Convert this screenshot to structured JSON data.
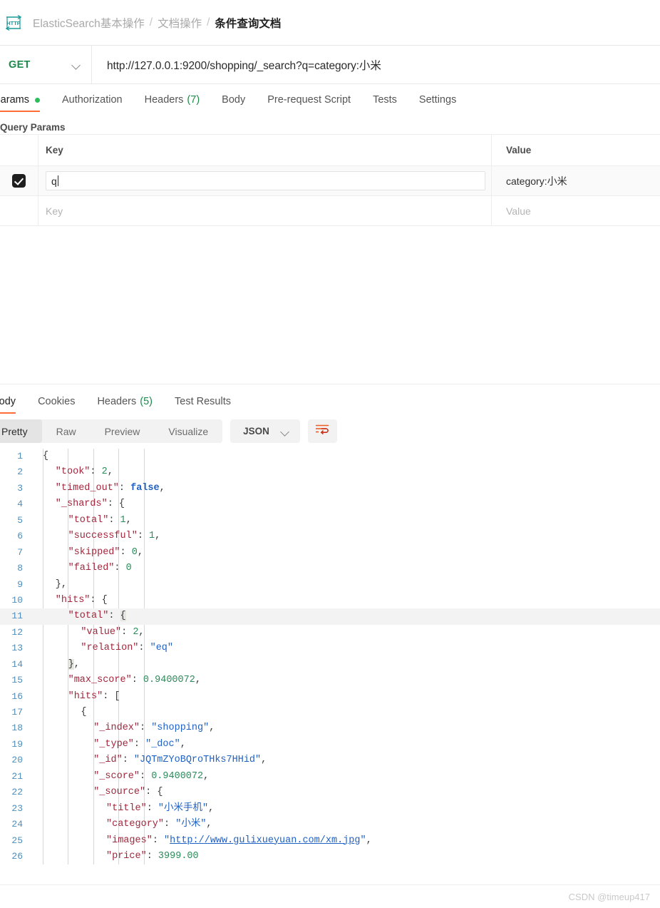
{
  "breadcrumb": {
    "icon": "http-protocol-icon",
    "items": [
      "ElasticSearch基本操作",
      "文档操作",
      "条件查询文档"
    ],
    "separator": "/"
  },
  "request": {
    "method": "GET",
    "url": "http://127.0.0.1:9200/shopping/_search?q=category:小米",
    "tabs": [
      {
        "label": "Params",
        "active": true,
        "dot": true
      },
      {
        "label": "Authorization",
        "active": false
      },
      {
        "label": "Headers",
        "count": "(7)",
        "active": false
      },
      {
        "label": "Body",
        "active": false
      },
      {
        "label": "Pre-request Script",
        "active": false
      },
      {
        "label": "Tests",
        "active": false
      },
      {
        "label": "Settings",
        "active": false
      }
    ]
  },
  "query_params": {
    "section_title": "Query Params",
    "headers": {
      "key": "Key",
      "value": "Value"
    },
    "rows": [
      {
        "checked": true,
        "key": "q",
        "value": "category:小米"
      },
      {
        "checked": false,
        "key_placeholder": "Key",
        "value_placeholder": "Value"
      }
    ]
  },
  "response": {
    "tabs": [
      {
        "label": "Body",
        "active": true
      },
      {
        "label": "Cookies",
        "active": false
      },
      {
        "label": "Headers",
        "count": "(5)",
        "active": false
      },
      {
        "label": "Test Results",
        "active": false
      }
    ],
    "view_modes": [
      {
        "label": "Pretty",
        "active": true
      },
      {
        "label": "Raw",
        "active": false
      },
      {
        "label": "Preview",
        "active": false
      },
      {
        "label": "Visualize",
        "active": false
      }
    ],
    "format_selected": "JSON",
    "wrap_icon": "word-wrap-icon",
    "body_lines": [
      {
        "no": "1",
        "indent": 0,
        "tokens": [
          {
            "t": "{",
            "c": "p"
          }
        ]
      },
      {
        "no": "2",
        "indent": 1,
        "tokens": [
          {
            "t": "\"took\"",
            "c": "k"
          },
          {
            "t": ": ",
            "c": "p"
          },
          {
            "t": "2",
            "c": "n"
          },
          {
            "t": ",",
            "c": "p"
          }
        ]
      },
      {
        "no": "3",
        "indent": 1,
        "tokens": [
          {
            "t": "\"timed_out\"",
            "c": "k"
          },
          {
            "t": ": ",
            "c": "p"
          },
          {
            "t": "false",
            "c": "b"
          },
          {
            "t": ",",
            "c": "p"
          }
        ]
      },
      {
        "no": "4",
        "indent": 1,
        "tokens": [
          {
            "t": "\"_shards\"",
            "c": "k"
          },
          {
            "t": ": ",
            "c": "p"
          },
          {
            "t": "{",
            "c": "p"
          }
        ]
      },
      {
        "no": "5",
        "indent": 2,
        "tokens": [
          {
            "t": "\"total\"",
            "c": "k"
          },
          {
            "t": ": ",
            "c": "p"
          },
          {
            "t": "1",
            "c": "n"
          },
          {
            "t": ",",
            "c": "p"
          }
        ]
      },
      {
        "no": "6",
        "indent": 2,
        "tokens": [
          {
            "t": "\"successful\"",
            "c": "k"
          },
          {
            "t": ": ",
            "c": "p"
          },
          {
            "t": "1",
            "c": "n"
          },
          {
            "t": ",",
            "c": "p"
          }
        ]
      },
      {
        "no": "7",
        "indent": 2,
        "tokens": [
          {
            "t": "\"skipped\"",
            "c": "k"
          },
          {
            "t": ": ",
            "c": "p"
          },
          {
            "t": "0",
            "c": "n"
          },
          {
            "t": ",",
            "c": "p"
          }
        ]
      },
      {
        "no": "8",
        "indent": 2,
        "tokens": [
          {
            "t": "\"failed\"",
            "c": "k"
          },
          {
            "t": ": ",
            "c": "p"
          },
          {
            "t": "0",
            "c": "n"
          }
        ]
      },
      {
        "no": "9",
        "indent": 1,
        "tokens": [
          {
            "t": "}",
            "c": "p"
          },
          {
            "t": ",",
            "c": "p"
          }
        ]
      },
      {
        "no": "10",
        "indent": 1,
        "tokens": [
          {
            "t": "\"hits\"",
            "c": "k"
          },
          {
            "t": ": ",
            "c": "p"
          },
          {
            "t": "{",
            "c": "p"
          }
        ]
      },
      {
        "no": "11",
        "indent": 2,
        "highlight": true,
        "tokens": [
          {
            "t": "\"total\"",
            "c": "k"
          },
          {
            "t": ": ",
            "c": "p"
          },
          {
            "t": "{",
            "c": "p brace-hl"
          }
        ]
      },
      {
        "no": "12",
        "indent": 3,
        "tokens": [
          {
            "t": "\"value\"",
            "c": "k"
          },
          {
            "t": ": ",
            "c": "p"
          },
          {
            "t": "2",
            "c": "n"
          },
          {
            "t": ",",
            "c": "p"
          }
        ]
      },
      {
        "no": "13",
        "indent": 3,
        "tokens": [
          {
            "t": "\"relation\"",
            "c": "k"
          },
          {
            "t": ": ",
            "c": "p"
          },
          {
            "t": "\"eq\"",
            "c": "s"
          }
        ]
      },
      {
        "no": "14",
        "indent": 2,
        "tokens": [
          {
            "t": "}",
            "c": "p brace-hl"
          },
          {
            "t": ",",
            "c": "p"
          }
        ]
      },
      {
        "no": "15",
        "indent": 2,
        "tokens": [
          {
            "t": "\"max_score\"",
            "c": "k"
          },
          {
            "t": ": ",
            "c": "p"
          },
          {
            "t": "0.9400072",
            "c": "n"
          },
          {
            "t": ",",
            "c": "p"
          }
        ]
      },
      {
        "no": "16",
        "indent": 2,
        "tokens": [
          {
            "t": "\"hits\"",
            "c": "k"
          },
          {
            "t": ": ",
            "c": "p"
          },
          {
            "t": "[",
            "c": "p"
          }
        ]
      },
      {
        "no": "17",
        "indent": 3,
        "tokens": [
          {
            "t": "{",
            "c": "p"
          }
        ]
      },
      {
        "no": "18",
        "indent": 4,
        "tokens": [
          {
            "t": "\"_index\"",
            "c": "k"
          },
          {
            "t": ": ",
            "c": "p"
          },
          {
            "t": "\"shopping\"",
            "c": "s"
          },
          {
            "t": ",",
            "c": "p"
          }
        ]
      },
      {
        "no": "19",
        "indent": 4,
        "tokens": [
          {
            "t": "\"_type\"",
            "c": "k"
          },
          {
            "t": ": ",
            "c": "p"
          },
          {
            "t": "\"_doc\"",
            "c": "s"
          },
          {
            "t": ",",
            "c": "p"
          }
        ]
      },
      {
        "no": "20",
        "indent": 4,
        "tokens": [
          {
            "t": "\"_id\"",
            "c": "k"
          },
          {
            "t": ": ",
            "c": "p"
          },
          {
            "t": "\"JQTmZYoBQroTHks7HHid\"",
            "c": "s"
          },
          {
            "t": ",",
            "c": "p"
          }
        ]
      },
      {
        "no": "21",
        "indent": 4,
        "tokens": [
          {
            "t": "\"_score\"",
            "c": "k"
          },
          {
            "t": ": ",
            "c": "p"
          },
          {
            "t": "0.9400072",
            "c": "n"
          },
          {
            "t": ",",
            "c": "p"
          }
        ]
      },
      {
        "no": "22",
        "indent": 4,
        "tokens": [
          {
            "t": "\"_source\"",
            "c": "k"
          },
          {
            "t": ": ",
            "c": "p"
          },
          {
            "t": "{",
            "c": "p"
          }
        ]
      },
      {
        "no": "23",
        "indent": 5,
        "tokens": [
          {
            "t": "\"title\"",
            "c": "k"
          },
          {
            "t": ": ",
            "c": "p"
          },
          {
            "t": "\"小米手机\"",
            "c": "s"
          },
          {
            "t": ",",
            "c": "p"
          }
        ]
      },
      {
        "no": "24",
        "indent": 5,
        "tokens": [
          {
            "t": "\"category\"",
            "c": "k"
          },
          {
            "t": ": ",
            "c": "p"
          },
          {
            "t": "\"小米\"",
            "c": "s"
          },
          {
            "t": ",",
            "c": "p"
          }
        ]
      },
      {
        "no": "25",
        "indent": 5,
        "tokens": [
          {
            "t": "\"images\"",
            "c": "k"
          },
          {
            "t": ": ",
            "c": "p"
          },
          {
            "t": "\"",
            "c": "s"
          },
          {
            "t": "http://www.gulixueyuan.com/xm.jpg",
            "c": "lnk"
          },
          {
            "t": "\"",
            "c": "s"
          },
          {
            "t": ",",
            "c": "p"
          }
        ]
      },
      {
        "no": "26",
        "indent": 5,
        "tokens": [
          {
            "t": "\"price\"",
            "c": "k"
          },
          {
            "t": ": ",
            "c": "p"
          },
          {
            "t": "3999.00",
            "c": "n"
          }
        ]
      }
    ]
  },
  "footer": {
    "watermark": "CSDN @timeup417"
  },
  "colors": {
    "accent": "#ff6c37",
    "method_get": "#1c8a4b",
    "dot_green": "#2dbd5c",
    "json_key": "#a3263c",
    "json_string": "#1f61c4",
    "json_number": "#2d8a5a",
    "line_number": "#4f8dbb"
  }
}
